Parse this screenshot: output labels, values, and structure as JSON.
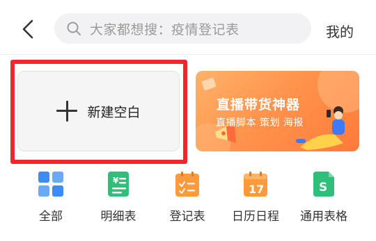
{
  "header": {
    "search_placeholder": "大家都想搜：疫情登记表",
    "me_label": "我的"
  },
  "create": {
    "new_blank_label": "新建空白"
  },
  "banner": {
    "title": "直播带货神器",
    "subtitle": "直播脚本 策划 海报"
  },
  "shortcuts": [
    {
      "label": "全部",
      "icon": "grid-icon",
      "color": "#3d8bf5"
    },
    {
      "label": "明细表",
      "icon": "ledger-icon",
      "color": "#2fbf7a"
    },
    {
      "label": "登记表",
      "icon": "register-icon",
      "color": "#ff9a3c"
    },
    {
      "label": "日历日程",
      "icon": "calendar-icon",
      "color": "#ff9a3c"
    },
    {
      "label": "通用表格",
      "icon": "spreadsheet-icon",
      "color": "#2fbf7a"
    }
  ],
  "colors": {
    "highlight": "#f0272c",
    "banner_start": "#ffb26a",
    "banner_end": "#ff7a3a"
  }
}
